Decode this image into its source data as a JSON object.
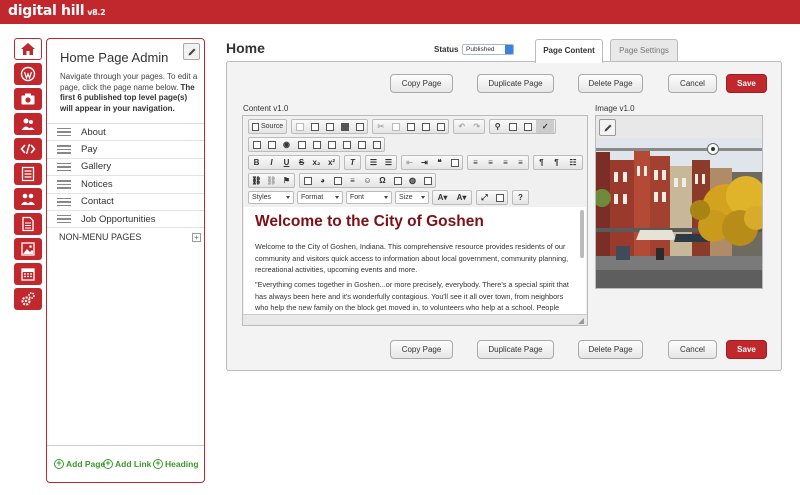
{
  "brand": {
    "name": "digital hill",
    "version": "v8.2"
  },
  "rail": [
    {
      "name": "home-icon",
      "active": true
    },
    {
      "name": "wordpress-icon"
    },
    {
      "name": "camera-icon"
    },
    {
      "name": "users-icon"
    },
    {
      "name": "code-icon"
    },
    {
      "name": "list-icon"
    },
    {
      "name": "people-icon"
    },
    {
      "name": "document-icon"
    },
    {
      "name": "image-icon"
    },
    {
      "name": "calendar-icon"
    },
    {
      "name": "gears-icon"
    }
  ],
  "panel": {
    "title": "Home Page Admin",
    "desc_plain": "Navigate through your pages. To edit a page, click the page name below. ",
    "desc_bold": "The first 6 published top level page(s) will appear in your navigation.",
    "pages": [
      "About",
      "Pay",
      "Gallery",
      "Notices",
      "Contact",
      "Job Opportunities"
    ],
    "non_menu": "NON-MENU PAGES",
    "add_page": "Add Page",
    "add_link": "Add Link",
    "heading": "Heading"
  },
  "main": {
    "heading": "Home",
    "status_label": "Status",
    "status_value": "Published",
    "tab_content": "Page Content",
    "tab_settings": "Page Settings",
    "copy_page": "Copy Page",
    "duplicate_page": "Duplicate Page",
    "delete_page": "Delete Page",
    "cancel": "Cancel",
    "save": "Save",
    "content_label": "Content v1.0",
    "image_label": "Image v1.0"
  },
  "editor": {
    "source": "Source",
    "styles": "Styles",
    "format": "Format",
    "font": "Font",
    "size": "Size",
    "title": "Welcome to the City of Goshen",
    "p1": "Welcome to the City of Goshen, Indiana. This comprehensive resource provides residents of our community and visitors quick access to information about local government, community planning, recreational activities, upcoming events and more.",
    "p2": "\"Everything comes together in Goshen...or more precisely, everybody. There's a special spirit that has always been here and it's wonderfully contagious. You'll see it all over town, from neighbors who help the new family on the block get moved in, to volunteers who help at a school.  People here are"
  },
  "colors": {
    "brand_red": "#c0282d",
    "heading_red": "#7e1017",
    "link_green": "#3a9a2a"
  }
}
